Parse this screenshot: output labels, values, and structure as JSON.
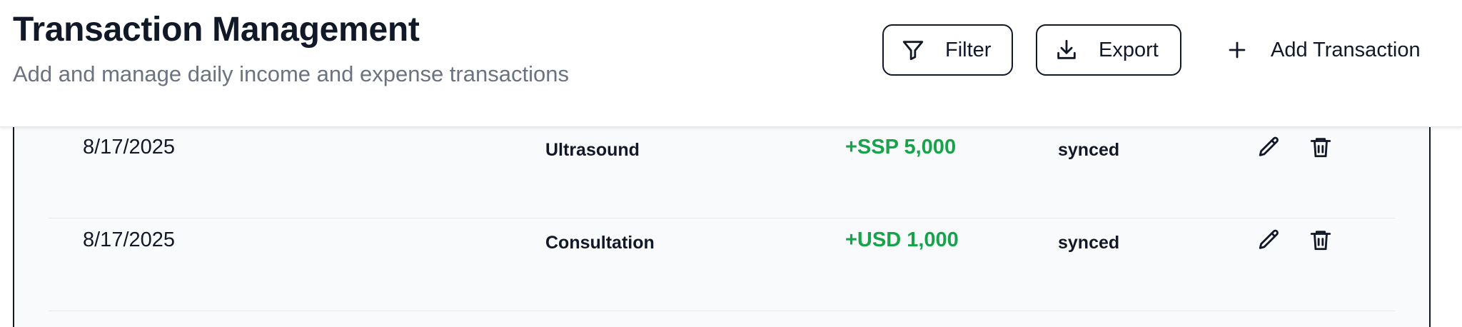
{
  "header": {
    "title": "Transaction Management",
    "subtitle": "Add and manage daily income and expense transactions",
    "filter_label": "Filter",
    "export_label": "Export",
    "add_label": "Add Transaction"
  },
  "colors": {
    "income_amount": "#16a34a",
    "text_primary": "#111827",
    "text_secondary": "#6b7280",
    "row_background": "#f9fafb"
  },
  "icons": {
    "filter": "funnel-icon",
    "export": "download-icon",
    "add": "plus-icon",
    "edit": "pencil-icon",
    "delete": "trash-icon"
  },
  "transactions": [
    {
      "date": "8/17/2025",
      "description": "Ultrasound",
      "amount": "+SSP 5,000",
      "status": "synced"
    },
    {
      "date": "8/17/2025",
      "description": "Consultation",
      "amount": "+USD 1,000",
      "status": "synced"
    }
  ]
}
